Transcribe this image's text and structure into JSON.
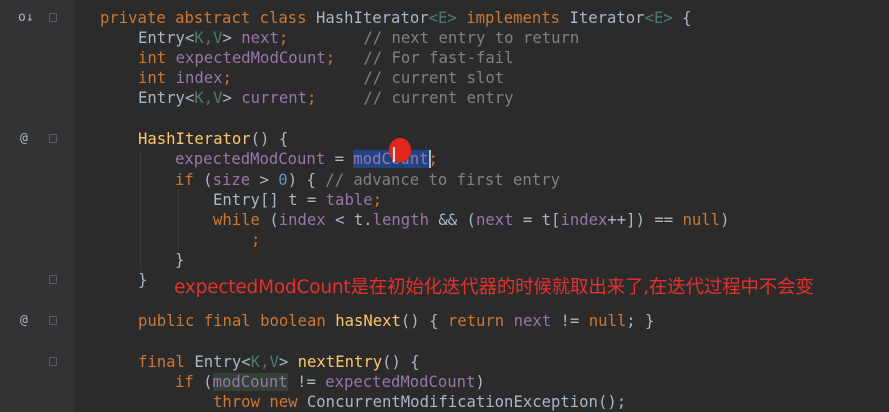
{
  "gutter": {
    "override_icon": "o↓",
    "at_icon": "@"
  },
  "code": {
    "l1_kw1": "private",
    "l1_kw2": "abstract",
    "l1_kw3": "class",
    "l1_name": "HashIterator",
    "l1_gen": "<E>",
    "l1_kw4": "implements",
    "l1_iface": "Iterator",
    "l1_gen2": "<E>",
    "l1_brace": " {",
    "l2_type": "Entry<",
    "l2_gen": "K,V",
    "l2_type2": ">",
    "l2_field": "next",
    "l2_semi": ";",
    "l2_cmt": "// next entry to return",
    "l3_kw": "int",
    "l3_field": "expectedModCount",
    "l3_semi": ";",
    "l3_cmt": "// For fast-fail",
    "l4_kw": "int",
    "l4_field": "index",
    "l4_semi": ";",
    "l4_cmt": "// current slot",
    "l5_type": "Entry<",
    "l5_gen": "K,V",
    "l5_type2": ">",
    "l5_field": "current",
    "l5_semi": ";",
    "l5_cmt": "// current entry",
    "l6_fn": "HashIterator",
    "l6_rest": "() {",
    "l7_field": "expectedModCount",
    "l7_eq": " = ",
    "l7_mod": "modCount",
    "l7_semi": ";",
    "l8_kw": "if",
    "l8_p1": " (",
    "l8_field": "size",
    "l8_op": " > ",
    "l8_num": "0",
    "l8_p2": ") { ",
    "l8_cmt": "// advance to first entry",
    "l9_type": "Entry[] t = ",
    "l9_field": "table",
    "l9_semi": ";",
    "l10_kw": "while",
    "l10_a": " (",
    "l10_f1": "index",
    "l10_b": " < t.",
    "l10_f2": "length",
    "l10_c": " && (",
    "l10_f3": "next",
    "l10_d": " = t[",
    "l10_f4": "index",
    "l10_e": "++]) == ",
    "l10_null": "null",
    "l10_f": ")",
    "l11_semi": ";",
    "l12_brace": "}",
    "l13_brace": "}",
    "l14_kw1": "public",
    "l14_kw2": "final",
    "l14_kw3": "boolean",
    "l14_fn": "hasNext",
    "l14_a": "() { ",
    "l14_kw4": "return",
    "l14_field": "next",
    "l14_b": " != ",
    "l14_null": "null",
    "l14_c": "; }",
    "l15_kw": "final",
    "l15_type": "Entry<",
    "l15_gen": "K,V",
    "l15_type2": "> ",
    "l15_fn": "nextEntry",
    "l15_rest": "() {",
    "l16_kw": "if",
    "l16_a": " (",
    "l16_f1": "modCount",
    "l16_b": " != ",
    "l16_f2": "expectedModCount",
    "l16_c": ")",
    "l17_kw1": "throw",
    "l17_kw2": "new",
    "l17_rest": " ConcurrentModificationException();"
  },
  "annotation": "expectedModCount是在初始化迭代器的时候就取出来了,在迭代过程中不会变",
  "cursor_glyph": "I"
}
